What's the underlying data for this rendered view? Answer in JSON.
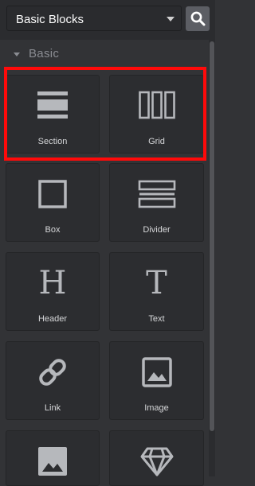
{
  "toolbar": {
    "select_value": "Basic Blocks",
    "search_icon": "search-icon",
    "chevron_icon": "chevron-down-icon"
  },
  "category": {
    "label": "Basic",
    "caret_icon": "caret-down-icon"
  },
  "blocks": [
    {
      "label": "Section",
      "icon": "section-icon"
    },
    {
      "label": "Grid",
      "icon": "grid-icon"
    },
    {
      "label": "Box",
      "icon": "box-icon"
    },
    {
      "label": "Divider",
      "icon": "divider-icon"
    },
    {
      "label": "Header",
      "icon": "header-icon",
      "glyph": "H"
    },
    {
      "label": "Text",
      "icon": "text-icon",
      "glyph": "T"
    },
    {
      "label": "Link",
      "icon": "link-icon"
    },
    {
      "label": "Image",
      "icon": "image-icon"
    },
    {
      "label": "",
      "icon": "image-icon"
    },
    {
      "label": "",
      "icon": "diamond-icon"
    }
  ],
  "colors": {
    "panel_bg": "#323336",
    "block_bg": "#2c2d30",
    "icon": "#b6b8bc",
    "highlight": "#ff0a0a"
  }
}
